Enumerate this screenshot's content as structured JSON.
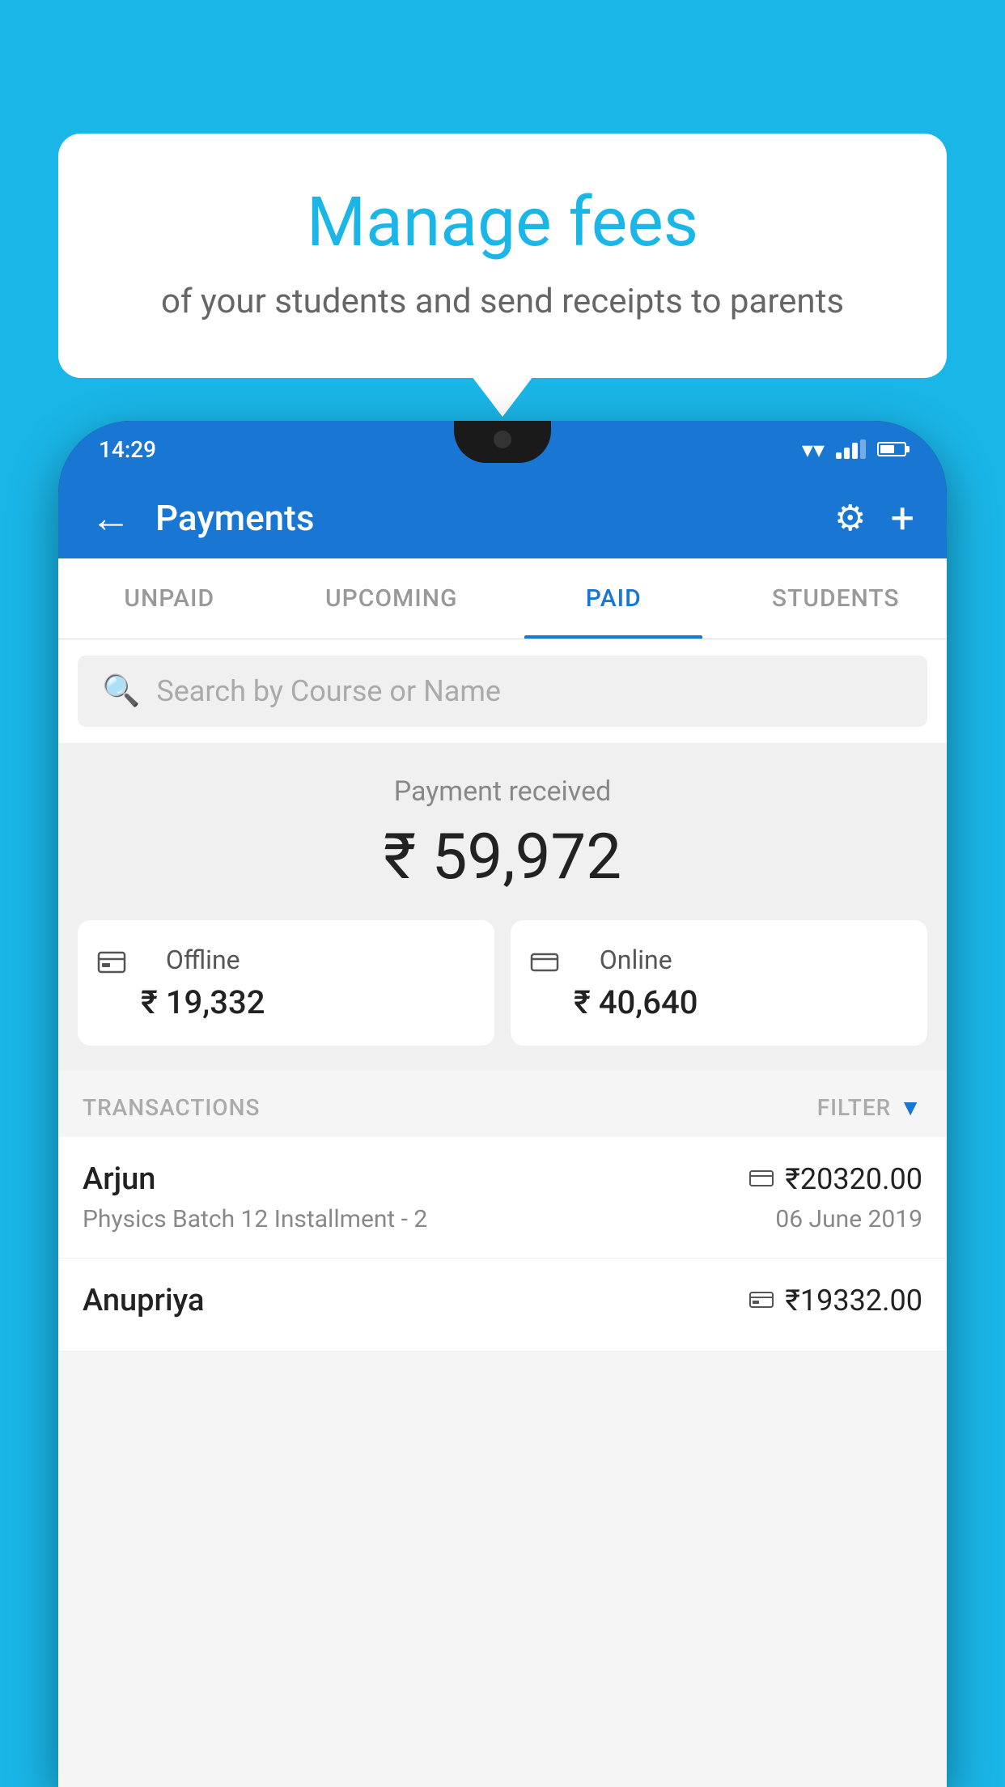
{
  "background_color": "#1ab6e8",
  "speech_bubble": {
    "title": "Manage fees",
    "subtitle": "of your students and send receipts to parents"
  },
  "phone": {
    "status_bar": {
      "time": "14:29"
    },
    "app_header": {
      "title": "Payments",
      "back_label": "←",
      "plus_label": "+"
    },
    "tabs": [
      {
        "label": "UNPAID",
        "active": false
      },
      {
        "label": "UPCOMING",
        "active": false
      },
      {
        "label": "PAID",
        "active": true
      },
      {
        "label": "STUDENTS",
        "active": false
      }
    ],
    "search": {
      "placeholder": "Search by Course or Name"
    },
    "payment_received": {
      "label": "Payment received",
      "total": "₹ 59,972",
      "offline_label": "Offline",
      "offline_amount": "₹ 19,332",
      "online_label": "Online",
      "online_amount": "₹ 40,640"
    },
    "transactions": {
      "header_label": "TRANSACTIONS",
      "filter_label": "FILTER",
      "rows": [
        {
          "name": "Arjun",
          "amount": "₹20320.00",
          "course": "Physics Batch 12 Installment - 2",
          "date": "06 June 2019",
          "payment_type": "online"
        },
        {
          "name": "Anupriya",
          "amount": "₹19332.00",
          "course": "",
          "date": "",
          "payment_type": "offline"
        }
      ]
    }
  }
}
